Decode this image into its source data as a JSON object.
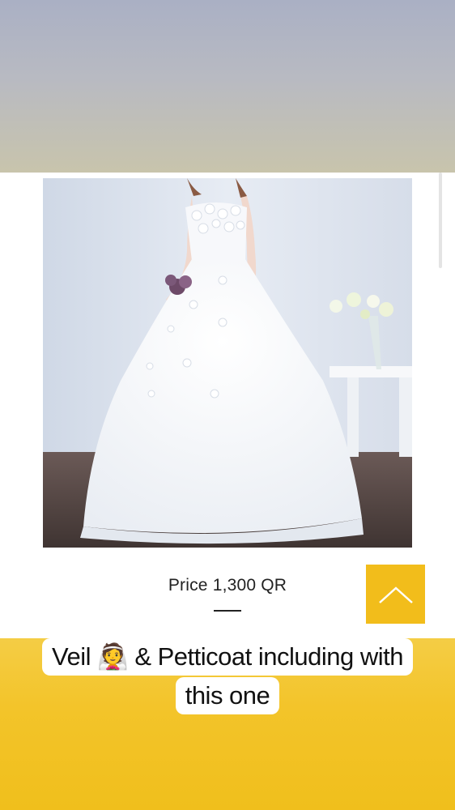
{
  "product": {
    "image": "wedding-dress-photo",
    "price": "Price 1,300 QR"
  },
  "navigation": {
    "back_to_top_icon": "chevron-up-icon"
  },
  "caption": {
    "line1": "Veil 👰 & Petticoat  including with",
    "line2": "this one"
  },
  "colors": {
    "accent_yellow": "#f2bd1b",
    "caption_bg": "#ffffff"
  }
}
